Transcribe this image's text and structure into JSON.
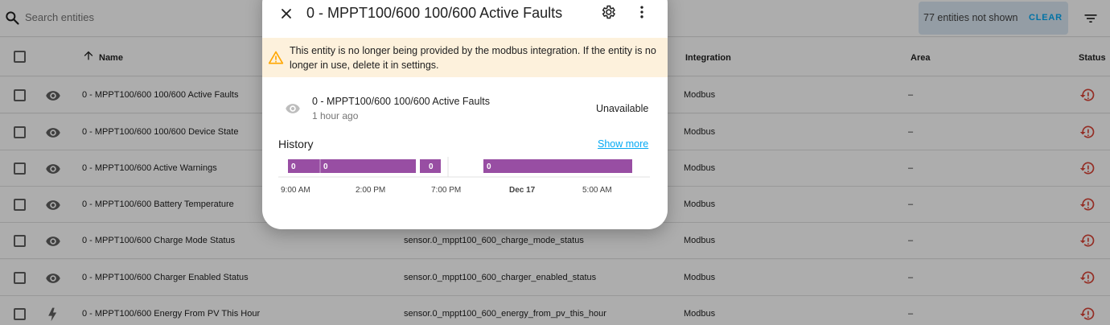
{
  "search": {
    "placeholder": "Search entities"
  },
  "filter_chip": {
    "text": "77 entities not shown",
    "clear_label": "CLEAR"
  },
  "table": {
    "headers": {
      "name": "Name",
      "integration": "Integration",
      "area": "Area",
      "status": "Status"
    },
    "rows": [
      {
        "name": "0 - MPPT100/600 100/600 Active Faults",
        "entity_id": "",
        "integration": "Modbus",
        "area": "–",
        "icon": "eye-icon"
      },
      {
        "name": "0 - MPPT100/600 100/600 Device State",
        "entity_id": "",
        "integration": "Modbus",
        "area": "–",
        "icon": "eye-icon"
      },
      {
        "name": "0 - MPPT100/600 Active Warnings",
        "entity_id": "",
        "integration": "Modbus",
        "area": "–",
        "icon": "eye-icon"
      },
      {
        "name": "0 - MPPT100/600 Battery Temperature",
        "entity_id": "",
        "integration": "Modbus",
        "area": "–",
        "icon": "eye-icon"
      },
      {
        "name": "0 - MPPT100/600 Charge Mode Status",
        "entity_id": "sensor.0_mppt100_600_charge_mode_status",
        "integration": "Modbus",
        "area": "–",
        "icon": "eye-icon"
      },
      {
        "name": "0 - MPPT100/600 Charger Enabled Status",
        "entity_id": "sensor.0_mppt100_600_charger_enabled_status",
        "integration": "Modbus",
        "area": "–",
        "icon": "eye-icon"
      },
      {
        "name": "0 - MPPT100/600 Energy From PV This Hour",
        "entity_id": "sensor.0_mppt100_600_energy_from_pv_this_hour",
        "integration": "Modbus",
        "area": "–",
        "icon": "lightning-icon"
      }
    ]
  },
  "dialog": {
    "title": "0 - MPPT100/600 100/600 Active Faults",
    "alert": "This entity is no longer being provided by the modbus integration. If the entity is no longer in use, delete it in settings.",
    "entity_name": "0 - MPPT100/600 100/600 Active Faults",
    "entity_time": "1 hour ago",
    "entity_state": "Unavailable",
    "history_label": "History",
    "show_more": "Show more",
    "timeline": {
      "bar_color": "#984ea3",
      "segments": [
        {
          "label": "0"
        },
        {
          "label": "0"
        },
        {
          "label": "0"
        },
        {
          "label": "0"
        }
      ],
      "ticks": [
        "9:00 AM",
        "2:00 PM",
        "7:00 PM",
        "Dec 17",
        "5:00 AM"
      ]
    }
  },
  "colors": {
    "accent": "#03a9f4",
    "status_error": "#db4437",
    "alert_bg": "#fdf1dc",
    "alert_icon": "#ffa600"
  }
}
